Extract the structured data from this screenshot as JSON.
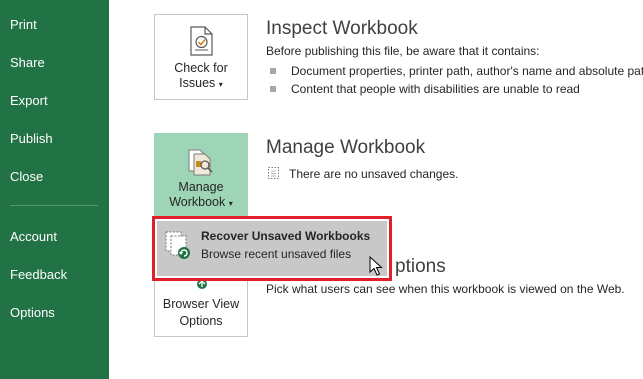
{
  "sidebar": {
    "items": [
      {
        "label": "Print"
      },
      {
        "label": "Share"
      },
      {
        "label": "Export"
      },
      {
        "label": "Publish"
      },
      {
        "label": "Close"
      },
      {
        "label": "Account"
      },
      {
        "label": "Feedback"
      },
      {
        "label": "Options"
      }
    ],
    "background": "#217346"
  },
  "inspect": {
    "button_line1": "Check for",
    "button_line2": "Issues",
    "title": "Inspect Workbook",
    "description": "Before publishing this file, be aware that it contains:",
    "bullets": [
      "Document properties, printer path, author's name and absolute pat",
      "Content that people with disabilities are unable to read"
    ]
  },
  "manage": {
    "button_line1": "Manage",
    "button_line2": "Workbook",
    "title": "Manage Workbook",
    "status": "There are no unsaved changes."
  },
  "browser": {
    "button_line1": "Browser View",
    "button_line2": "Options",
    "title_partial": "ptions",
    "description": "Pick what users can see when this workbook is viewed on the Web."
  },
  "popup": {
    "title": "Recover Unsaved Workbooks",
    "subtitle": "Browse recent unsaved files",
    "highlight_color": "#e0202a"
  }
}
